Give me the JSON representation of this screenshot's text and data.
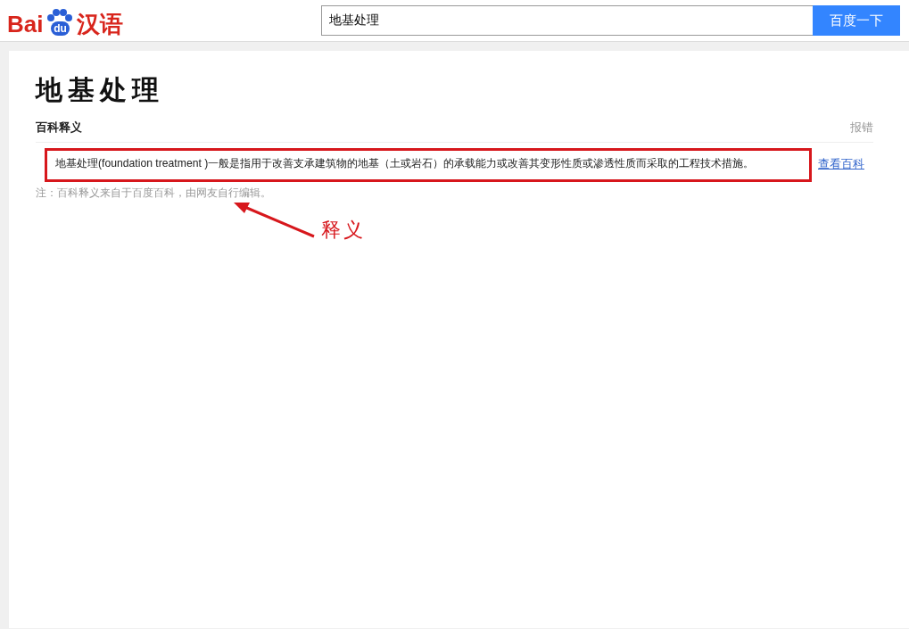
{
  "header": {
    "logo": {
      "text_left": "Bai",
      "text_paw": "du",
      "text_right": "汉语"
    },
    "search": {
      "value": "地基处理"
    },
    "search_button": "百度一下"
  },
  "entry": {
    "title": "地基处理",
    "section": {
      "heading": "百科释义",
      "report_link": "报错"
    },
    "definition": "地基处理(foundation treatment )一般是指用于改善支承建筑物的地基（土或岩石）的承载能力或改善其变形性质或渗透性质而采取的工程技术措施。",
    "more_link": "查看百科",
    "note": "注：百科释义来自于百度百科，由网友自行编辑。"
  },
  "annotation": {
    "label": "释义"
  }
}
